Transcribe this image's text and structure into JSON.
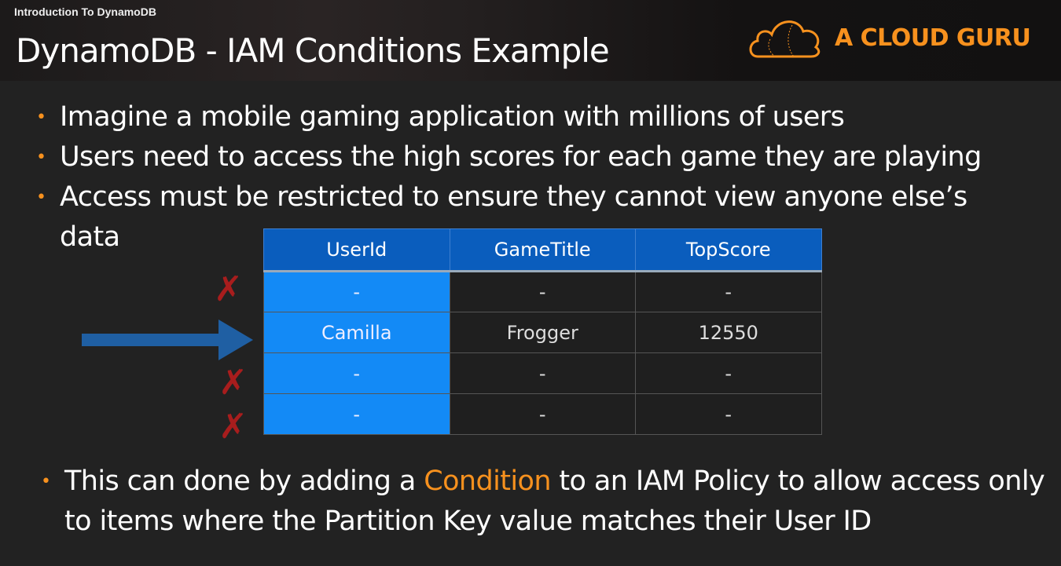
{
  "header": {
    "course": "Introduction To DynamoDB",
    "title": "DynamoDB - IAM Conditions Example",
    "logo_text": "A CLOUD GURU"
  },
  "bullets": [
    "Imagine a mobile gaming application with millions of users",
    "Users need to access the high scores for each game they are playing",
    "Access must be restricted to ensure they cannot view anyone else’s data"
  ],
  "table": {
    "headers": [
      "UserId",
      "GameTitle",
      "TopScore"
    ],
    "rows": [
      [
        "-",
        "-",
        "-"
      ],
      [
        "Camilla",
        "Frogger",
        "12550"
      ],
      [
        "-",
        "-",
        "-"
      ],
      [
        "-",
        "-",
        "-"
      ]
    ]
  },
  "bottom": {
    "pre": "This can done by adding a ",
    "highlight": "Condition",
    "post": " to an IAM Policy to allow access only to items where the Partition Key value matches their User ID"
  },
  "colors": {
    "accent": "#f7911e",
    "header_blue": "#0a5dbd",
    "key_blue": "#138af6",
    "deny_red": "#a81d1d",
    "arrow_blue": "#1f5fa3"
  }
}
